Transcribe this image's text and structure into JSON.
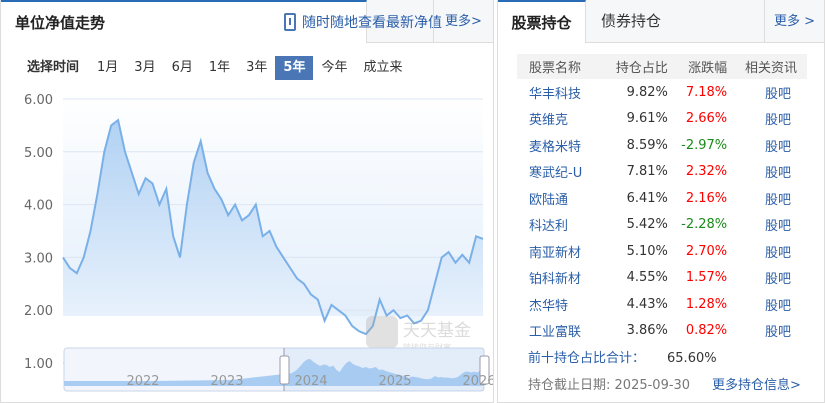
{
  "left": {
    "title": "单位净值走势",
    "app_promo": "随时随地查看最新净值",
    "more": "更多>",
    "time_label": "选择时间",
    "time_options": [
      "1月",
      "3月",
      "6月",
      "1年",
      "3年",
      "5年",
      "今年",
      "成立来"
    ],
    "selected_time": "5年",
    "watermark": "天天基金 链接您与财富"
  },
  "chart_data": {
    "type": "area",
    "ylim": [
      1,
      6
    ],
    "y_ticks": [
      "6.00",
      "5.00",
      "4.00",
      "3.00",
      "2.00",
      "1.00"
    ],
    "navigator_x_ticks": [
      "2022",
      "2023",
      "2024",
      "2025",
      "2026"
    ],
    "values": [
      3.0,
      2.8,
      2.7,
      3.0,
      3.5,
      4.2,
      5.0,
      5.5,
      5.6,
      5.0,
      4.6,
      4.2,
      4.5,
      4.4,
      4.0,
      4.3,
      3.4,
      3.0,
      4.0,
      4.8,
      5.2,
      4.6,
      4.3,
      4.1,
      3.8,
      4.0,
      3.7,
      3.8,
      4.0,
      3.4,
      3.5,
      3.2,
      3.0,
      2.8,
      2.6,
      2.5,
      2.3,
      2.2,
      1.8,
      2.1,
      2.0,
      1.9,
      1.7,
      1.6,
      1.55,
      1.7,
      2.2,
      1.9,
      2.0,
      1.85,
      1.9,
      1.75,
      1.8,
      2.0,
      2.5,
      3.0,
      3.1,
      2.9,
      3.05,
      2.9,
      3.4,
      3.35
    ],
    "line_color": "#7ab0e8"
  },
  "right": {
    "tabs": [
      "股票持仓",
      "债券持仓"
    ],
    "more": "更多 >",
    "columns": [
      "股票名称",
      "持仓占比",
      "涨跌幅",
      "相关资讯"
    ],
    "rows": [
      {
        "name": "华丰科技",
        "weight": "9.82%",
        "change": "7.18%",
        "dir": "up",
        "link": "股吧"
      },
      {
        "name": "英维克",
        "weight": "9.61%",
        "change": "2.66%",
        "dir": "up",
        "link": "股吧"
      },
      {
        "name": "麦格米特",
        "weight": "8.59%",
        "change": "-2.97%",
        "dir": "down",
        "link": "股吧"
      },
      {
        "name": "寒武纪-U",
        "weight": "7.81%",
        "change": "2.32%",
        "dir": "up",
        "link": "股吧"
      },
      {
        "name": "欧陆通",
        "weight": "6.41%",
        "change": "2.16%",
        "dir": "up",
        "link": "股吧"
      },
      {
        "name": "科达利",
        "weight": "5.42%",
        "change": "-2.28%",
        "dir": "down",
        "link": "股吧"
      },
      {
        "name": "南亚新材",
        "weight": "5.10%",
        "change": "2.70%",
        "dir": "up",
        "link": "股吧"
      },
      {
        "name": "铂科新材",
        "weight": "4.55%",
        "change": "1.57%",
        "dir": "up",
        "link": "股吧"
      },
      {
        "name": "杰华特",
        "weight": "4.43%",
        "change": "1.28%",
        "dir": "up",
        "link": "股吧"
      },
      {
        "name": "工业富联",
        "weight": "3.86%",
        "change": "0.82%",
        "dir": "up",
        "link": "股吧"
      }
    ],
    "total_label": "前十持仓占比合计：",
    "total_value": "65.60%",
    "date_label": "持仓截止日期:",
    "date_value": "2025-09-30",
    "more_holdings": "更多持仓信息>"
  }
}
